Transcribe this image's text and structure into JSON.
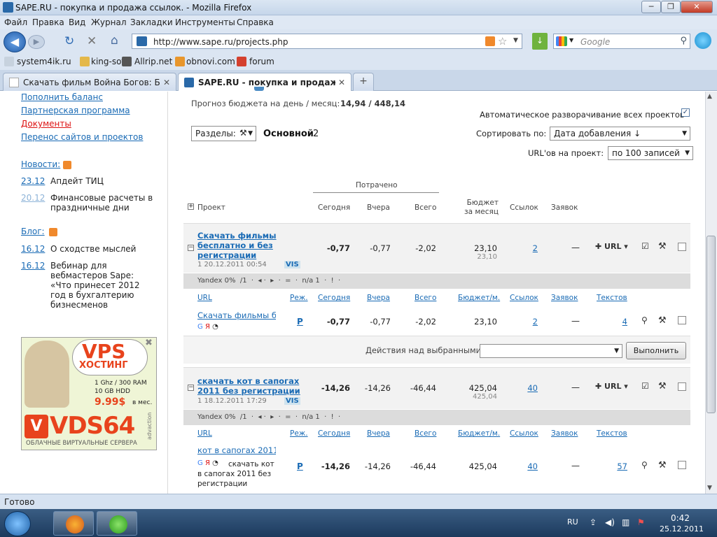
{
  "window": {
    "title": "SAPE.RU - покупка и продажа ссылок. - Mozilla Firefox"
  },
  "menu": [
    "Файл",
    "Правка",
    "Вид",
    "Журнал",
    "Закладки",
    "Инструменты",
    "Справка"
  ],
  "nav": {
    "url": "http://www.sape.ru/projects.php",
    "search_placeholder": "Google"
  },
  "bookmarks": [
    "system4ik.ru",
    "king-soft",
    "Allrip.net",
    "obnovi.com",
    "forum"
  ],
  "tabs": [
    {
      "label": "Скачать фильм Война Богов: Бесс..."
    },
    {
      "label": "SAPE.RU - покупка и продажа сс..."
    }
  ],
  "sidebar": {
    "links": [
      {
        "label": "Пополнить баланс"
      },
      {
        "label": "Партнерская программа"
      },
      {
        "label": "Документы"
      },
      {
        "label": "Перенос сайтов и проектов"
      }
    ],
    "news_title": "Новости:",
    "news": [
      {
        "date": "23.12",
        "text": "Апдейт ТИЦ"
      },
      {
        "date": "20.12",
        "text": "Финансовые расчеты в праздничные дни"
      }
    ],
    "blog_title": "Блог:",
    "blog": [
      {
        "date": "16.12",
        "text": "О сходстве мыслей"
      },
      {
        "date": "16.12",
        "text": "Вебинар для вебмастеров Sape: «Что принесет 2012 год в бухгалтерию бизнесменов"
      }
    ],
    "ad": {
      "vps": "VPS",
      "hosting": "ХОСТИНГ",
      "spec1": "1 Ghz / 300 RAM",
      "spec2": "10 GB HDD",
      "price": "9.99$",
      "per": "в мес.",
      "brand": "VDS64",
      "tagline": "ОБЛАЧНЫЕ ВИРТУАЛЬНЫЕ СЕРВЕРА",
      "side": "advaction"
    }
  },
  "forecast": {
    "label": "Прогноз бюджета на день / месяц:",
    "value": "14,94 / 448,14"
  },
  "auto_expand_label": "Автоматическое разворачивание всех проектов",
  "sections": {
    "label": "Разделы:",
    "current": "Основной",
    "count": "2"
  },
  "sort": {
    "label": "Сортировать по:",
    "value": "Дата добавления ↓"
  },
  "per_project": {
    "label": "URL'ов на проект:",
    "value": "по 100 записей"
  },
  "table_head": {
    "spent": "Потрачено",
    "project": "Проект",
    "today": "Сегодня",
    "yesterday": "Вчера",
    "total": "Всего",
    "budget": "Бюджет за месяц",
    "links": "Ссылок",
    "requests": "Заявок"
  },
  "sub_head": {
    "url": "URL",
    "mode": "Реж.",
    "today": "Сегодня",
    "yesterday": "Вчера",
    "total": "Всего",
    "budget": "Бюджет/м.",
    "links": "Ссылок",
    "requests": "Заявок",
    "texts": "Текстов"
  },
  "projects": [
    {
      "title": "Скачать фильмы бесплатно и без регистрации",
      "meta": "1 20.12.2011 00:54",
      "vis": "VIS",
      "today": "-0,77",
      "yesterday": "-0,77",
      "total": "-2,02",
      "budget": "23,10",
      "budget2": "23,10",
      "links": "2",
      "requests": "—",
      "url_btn": "URL",
      "stats": "Yandex 0%  /1  ·  ◂ ·  ▸  ·  =  ·  n/a 1  ·  !  ·",
      "row": {
        "url": "Скачать фильмы б",
        "extra": "",
        "mode": "P",
        "today": "-0,77",
        "yesterday": "-0,77",
        "total": "-2,02",
        "budget": "23,10",
        "links": "2",
        "requests": "—",
        "texts": "4"
      }
    },
    {
      "title": "скачать кот в сапогах 2011 без регистрации",
      "meta": "1 18.12.2011 17:29",
      "vis": "VIS",
      "today": "-14,26",
      "yesterday": "-14,26",
      "total": "-46,44",
      "budget": "425,04",
      "budget2": "425,04",
      "links": "40",
      "requests": "—",
      "url_btn": "URL",
      "stats": "Yandex 0%  /1  ·  ◂ ·  ▸  ·  =  ·  n/a 1  ·  !  ·",
      "row": {
        "url": "кот в сапогах 2011",
        "extra": "скачать кот в сапогах 2011 без регистрации",
        "mode": "P",
        "today": "-14,26",
        "yesterday": "-14,26",
        "total": "-46,44",
        "budget": "425,04",
        "links": "40",
        "requests": "—",
        "texts": "57"
      }
    }
  ],
  "actions": {
    "label": "Действия над выбранными:",
    "button": "Выполнить"
  },
  "status": "Готово",
  "tray": {
    "lang": "RU",
    "time": "0:42",
    "date": "25.12.2011"
  }
}
